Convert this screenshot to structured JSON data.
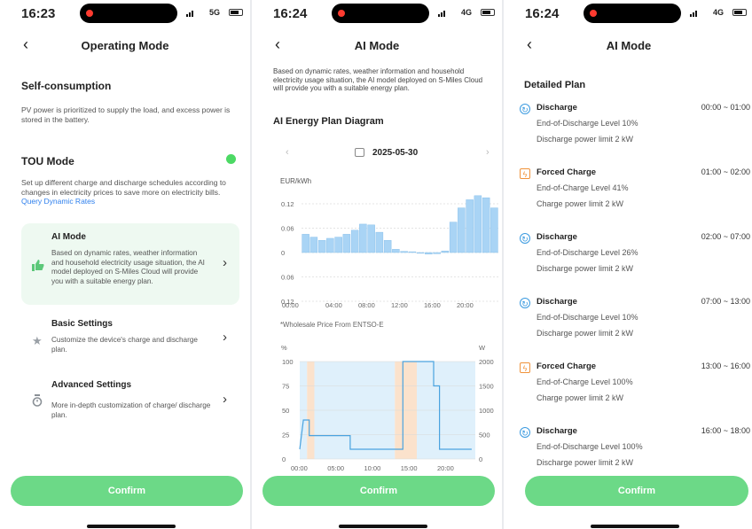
{
  "screens": {
    "operating": {
      "time": "16:23",
      "network": "5G",
      "title": "Operating Mode",
      "self_consumption": {
        "title": "Self-consumption",
        "desc": "PV power is prioritized to supply the load, and excess power is stored in the battery."
      },
      "tou": {
        "title": "TOU Mode",
        "desc": "Set up different charge and discharge schedules according to changes in electricity prices to save more on electricity bills.",
        "link": "Query Dynamic Rates",
        "toggle_on": true
      },
      "cards": [
        {
          "title": "AI Mode",
          "desc": "Based on dynamic rates, weather information and household electricity usage situation, the AI model deployed on S-Miles Cloud will provide you with a suitable energy plan.",
          "icon": "thumbs-up-icon"
        },
        {
          "title": "Basic Settings",
          "desc": "Customize the device's charge and discharge plan.",
          "icon": "star-icon"
        },
        {
          "title": "Advanced Settings",
          "desc": "More in-depth customization of charge/ discharge plan.",
          "icon": "timer-icon"
        }
      ],
      "confirm": "Confirm"
    },
    "ai_chart": {
      "time": "16:24",
      "network": "4G",
      "title": "AI Mode",
      "intro": "Based on dynamic rates, weather information and household electricity usage situation, the AI model deployed on S-Miles Cloud will provide you with a suitable energy plan.",
      "diagram_title": "AI Energy Plan Diagram",
      "date": "2025-05-30",
      "price_unit": "EUR/kWh",
      "price_ticks": [
        "0.12",
        "0.06",
        "0",
        "0.06",
        "0.12"
      ],
      "time_ticks": [
        "00:00",
        "04:00",
        "08:00",
        "12:00",
        "16:00",
        "20:00"
      ],
      "footnote": "*Wholesale Price From ENTSO-E",
      "soc_unit_left": "%",
      "soc_unit_right": "W",
      "soc_ticks_left": [
        "100",
        "75",
        "50",
        "25",
        "0"
      ],
      "soc_ticks_right": [
        "2000",
        "1500",
        "1000",
        "500",
        "0"
      ],
      "soc_time_ticks": [
        "00:00",
        "05:00",
        "10:00",
        "15:00",
        "20:00"
      ],
      "confirm": "Confirm"
    },
    "ai_plan": {
      "time": "16:24",
      "network": "4G",
      "title": "AI Mode",
      "plan_title": "Detailed Plan",
      "items": [
        {
          "type": "Discharge",
          "range": "00:00 ~ 01:00",
          "line1": "End-of-Discharge Level 10%",
          "line2": "Discharge power limit 2 kW",
          "kind": "discharge"
        },
        {
          "type": "Forced Charge",
          "range": "01:00 ~ 02:00",
          "line1": "End-of-Charge Level 41%",
          "line2": "Charge power limit 2 kW",
          "kind": "charge"
        },
        {
          "type": "Discharge",
          "range": "02:00 ~ 07:00",
          "line1": "End-of-Discharge Level 26%",
          "line2": "Discharge power limit 2 kW",
          "kind": "discharge"
        },
        {
          "type": "Discharge",
          "range": "07:00 ~ 13:00",
          "line1": "End-of-Discharge Level 10%",
          "line2": "Discharge power limit 2 kW",
          "kind": "discharge"
        },
        {
          "type": "Forced Charge",
          "range": "13:00 ~ 16:00",
          "line1": "End-of-Charge Level 100%",
          "line2": "Charge power limit 2 kW",
          "kind": "charge"
        },
        {
          "type": "Discharge",
          "range": "16:00 ~ 18:00",
          "line1": "End-of-Discharge Level 100%",
          "line2": "Discharge power limit 2 kW",
          "kind": "discharge"
        }
      ],
      "confirm": "Confirm"
    }
  },
  "colors": {
    "accent": "#6cd987",
    "link": "#2f80ed",
    "bar": "#a9d4f5",
    "charge_band": "#fbe2cc",
    "discharge_band": "#dff0fb",
    "line": "#4aa3df"
  },
  "chart_data": [
    {
      "type": "bar",
      "title": "AI Energy Plan Diagram",
      "ylabel": "EUR/kWh",
      "xlabel": "",
      "ylim": [
        -0.12,
        0.12
      ],
      "hours": [
        0,
        1,
        2,
        3,
        4,
        5,
        6,
        7,
        8,
        9,
        10,
        11,
        12,
        13,
        14,
        15,
        16,
        17,
        18,
        19,
        20,
        21,
        22,
        23
      ],
      "values": [
        0.045,
        0.038,
        0.03,
        0.035,
        0.038,
        0.045,
        0.055,
        0.07,
        0.068,
        0.05,
        0.03,
        0.008,
        0.003,
        0.002,
        -0.002,
        -0.004,
        -0.003,
        0.004,
        0.075,
        0.11,
        0.13,
        0.14,
        0.135,
        0.11
      ],
      "footnote": "*Wholesale Price From ENTSO-E"
    },
    {
      "type": "line",
      "ylabel_left": "%",
      "ylabel_right": "W",
      "ylim_left": [
        0,
        100
      ],
      "ylim_right": [
        0,
        2000
      ],
      "soc_steps": [
        [
          0,
          10
        ],
        [
          0.5,
          40
        ],
        [
          1.3,
          40
        ],
        [
          1.3,
          24
        ],
        [
          6.9,
          24
        ],
        [
          6.9,
          10
        ],
        [
          14.1,
          10
        ],
        [
          14.1,
          100
        ],
        [
          18.3,
          100
        ],
        [
          18.3,
          75
        ],
        [
          19.1,
          75
        ],
        [
          19.1,
          10
        ],
        [
          23.5,
          10
        ]
      ],
      "charge_windows": [
        [
          1,
          2
        ],
        [
          13,
          16
        ]
      ],
      "discharge_windows": [
        [
          0,
          1
        ],
        [
          2,
          13
        ],
        [
          16,
          24
        ]
      ]
    }
  ]
}
